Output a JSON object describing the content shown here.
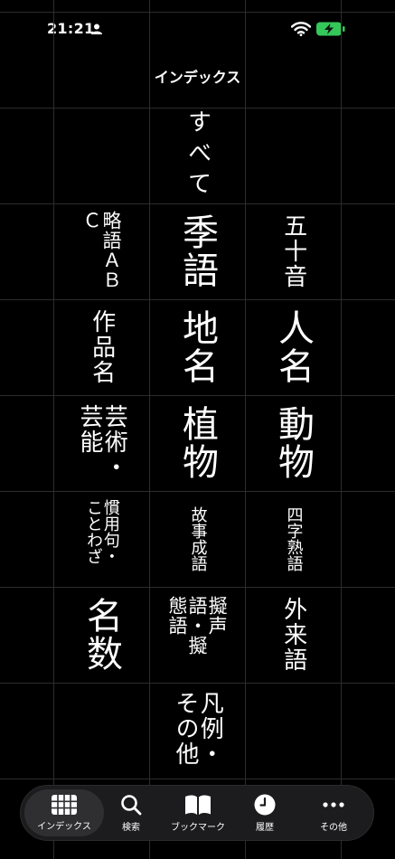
{
  "status": {
    "time": "21:21"
  },
  "title": "インデックス",
  "cells": {
    "all": "すべて",
    "abbr": "略語ＡＢＣ",
    "seasonal": "季語",
    "gojuon": "五十音",
    "works": "作品名",
    "place": "地名",
    "person": "人名",
    "arts": "芸術・芸能",
    "plants": "植物",
    "animals": "動物",
    "idioms": "慣用句・ことわざ",
    "proverbs": "故事成語",
    "yoji": "四字熟語",
    "numerals": "名数",
    "onomatopoeia": "擬声語・擬態語",
    "loanwords": "外来語",
    "misc": "凡例・その他"
  },
  "tabs": [
    {
      "label": "インデックス",
      "icon": "grid-icon"
    },
    {
      "label": "検索",
      "icon": "search-icon"
    },
    {
      "label": "ブックマーク",
      "icon": "book-icon"
    },
    {
      "label": "履歴",
      "icon": "clock-icon"
    },
    {
      "label": "その他",
      "icon": "more-icon"
    }
  ],
  "colors": {
    "background": "#000000",
    "grid": "#2c2c2c",
    "battery": "#34c759",
    "tabbar": "#1c1c1e"
  }
}
